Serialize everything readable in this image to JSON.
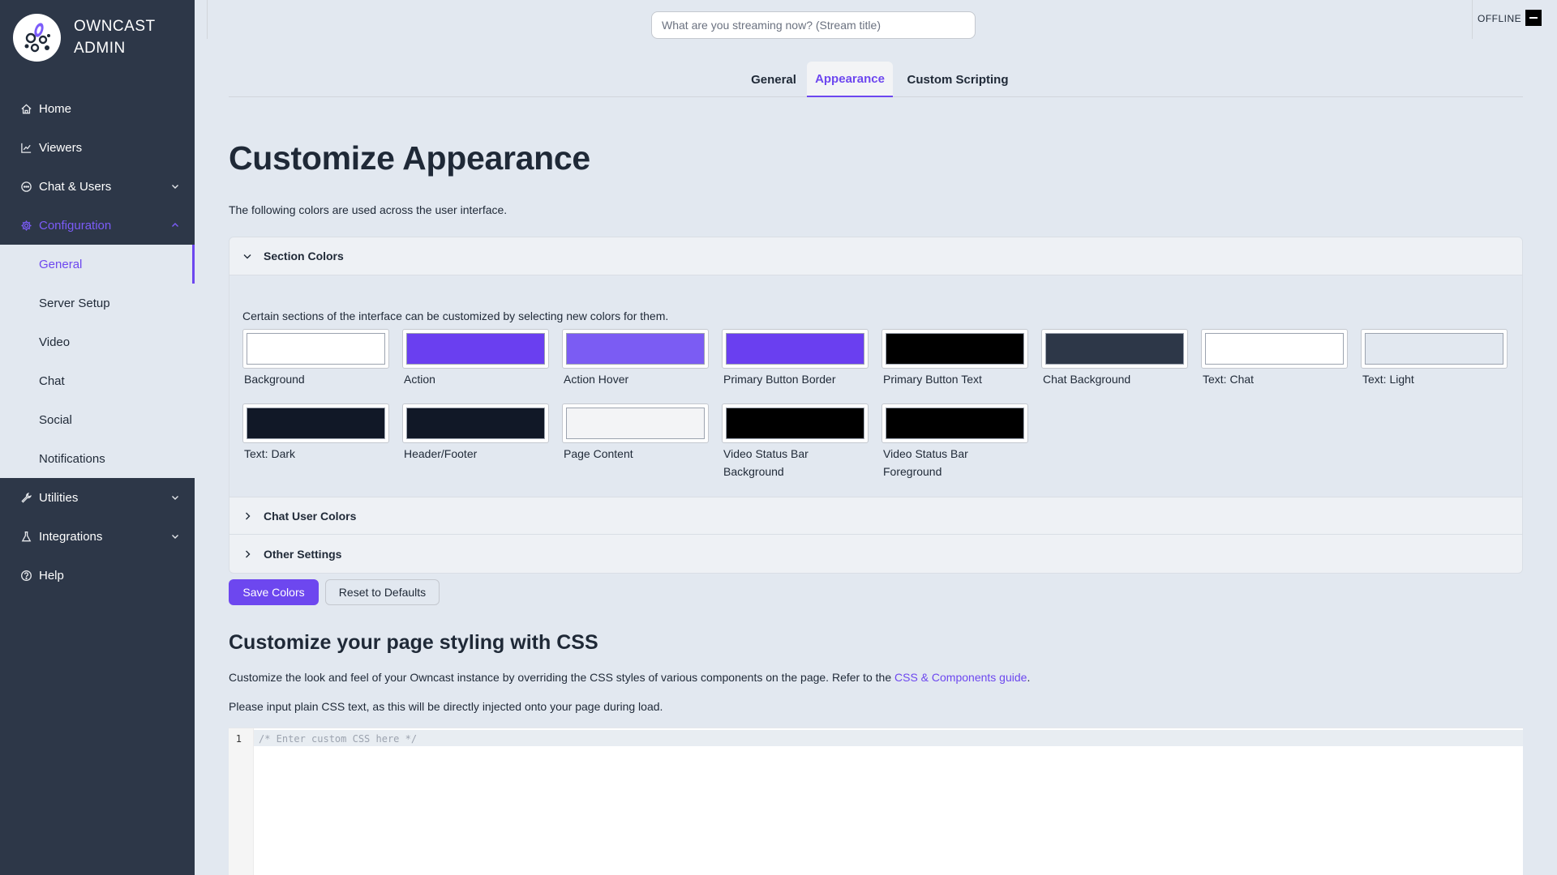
{
  "app": {
    "brand_line1": "OWNCAST",
    "brand_line2": "ADMIN"
  },
  "sidebar": {
    "items": [
      {
        "label": "Home",
        "icon": "home-icon"
      },
      {
        "label": "Viewers",
        "icon": "line-chart-icon"
      },
      {
        "label": "Chat & Users",
        "icon": "message-icon",
        "expandable": true
      },
      {
        "label": "Configuration",
        "icon": "gear-icon",
        "expandable": true,
        "expanded": true
      },
      {
        "label": "Utilities",
        "icon": "tool-icon",
        "expandable": true
      },
      {
        "label": "Integrations",
        "icon": "experiment-icon",
        "expandable": true
      },
      {
        "label": "Help",
        "icon": "question-icon"
      }
    ],
    "config_sub": [
      "General",
      "Server Setup",
      "Video",
      "Chat",
      "Social",
      "Notifications"
    ]
  },
  "header": {
    "title_placeholder": "What are you streaming now? (Stream title)",
    "status": "OFFLINE"
  },
  "tabs": [
    "General",
    "Appearance",
    "Custom Scripting"
  ],
  "main": {
    "title": "Customize Appearance",
    "description": "The following colors are used across the user interface.",
    "sections": {
      "section_colors": "Section Colors",
      "chat_user_colors": "Chat User Colors",
      "other_settings": "Other Settings"
    },
    "section_desc": "Certain sections of the interface can be customized by selecting new colors for them.",
    "colors": [
      {
        "label": "Background",
        "color": "#ffffff"
      },
      {
        "label": "Action",
        "color": "#6a3ff0"
      },
      {
        "label": "Action Hover",
        "color": "#7b5cf3"
      },
      {
        "label": "Primary Button Border",
        "color": "#6a3ff0"
      },
      {
        "label": "Primary Button Text",
        "color": "#000000"
      },
      {
        "label": "Chat Background",
        "color": "#2d3748"
      },
      {
        "label": "Text: Chat",
        "color": "#ffffff"
      },
      {
        "label": "Text: Light",
        "color": "#e2e8f0"
      },
      {
        "label": "Text: Dark",
        "color": "#111827"
      },
      {
        "label": "Header/Footer",
        "color": "#111827"
      },
      {
        "label": "Page Content",
        "color": "#f3f4f6"
      },
      {
        "label": "Video Status Bar Background",
        "color": "#000000"
      },
      {
        "label": "Video Status Bar Foreground",
        "color": "#000000"
      }
    ],
    "save_label": "Save Colors",
    "reset_label": "Reset to Defaults"
  },
  "css": {
    "title": "Customize your page styling with CSS",
    "desc1_before": "Customize the look and feel of your Owncast instance by overriding the CSS styles of various components on the page. Refer to the ",
    "desc1_link": "CSS & Components guide",
    "desc1_after": ".",
    "desc2": "Please input plain CSS text, as this will be directly injected onto your page during load.",
    "line_number": "1",
    "placeholder": "/* Enter custom CSS here */"
  },
  "colors": {
    "accent": "#6d47ef",
    "sidebar_bg": "#2d3748"
  }
}
